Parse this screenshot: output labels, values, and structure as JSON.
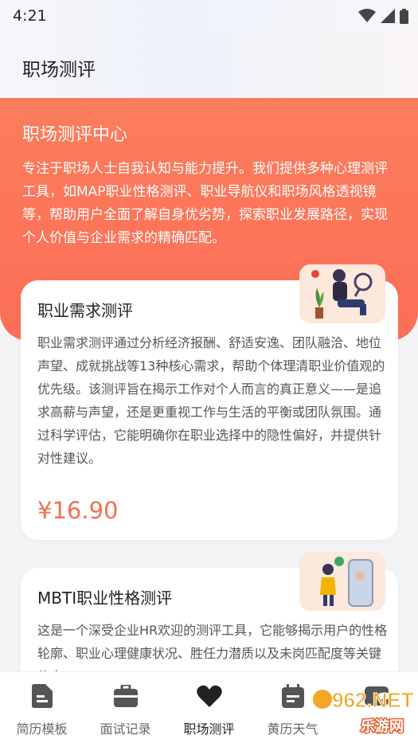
{
  "status_bar": {
    "time": "4:21"
  },
  "header": {
    "title": "职场测评"
  },
  "hero": {
    "title": "职场测评中心",
    "description": "专注于职场人士自我认知与能力提升。我们提供多种心理测评工具，如MAP职业性格测评、职业导航仪和职场风格透视镜等，帮助用户全面了解自身优劣势，探索职业发展路径，实现个人价值与企业需求的精确匹配。"
  },
  "cards": [
    {
      "title": "职业需求测评",
      "description": "职业需求测评通过分析经济报酬、舒适安逸、团队融洽、地位声望、成就挑战等13种核心需求，帮助个体理清职业价值观的优先级。该测评旨在揭示工作对个人而言的真正意义——是追求高薪与声望，还是更重视工作与生活的平衡或团队氛围。通过科学评估，它能明确你在职业选择中的隐性偏好，并提供针对性建议。",
      "price": "¥16.90"
    },
    {
      "title": "MBTI职业性格测评",
      "description": "这是一个深受企业HR欢迎的测评工具，它能够揭示用户的性格轮廓、职业心理健康状况、胜任力潜质以及未岗匹配度等关键信息"
    }
  ],
  "tabs": [
    {
      "label": "简历模板",
      "icon": "document-icon",
      "active": false
    },
    {
      "label": "面试记录",
      "icon": "briefcase-icon",
      "active": false
    },
    {
      "label": "职场测评",
      "icon": "heart-icon",
      "active": true
    },
    {
      "label": "黄历天气",
      "icon": "calendar-icon",
      "active": false
    },
    {
      "label": "",
      "icon": "wallet-icon",
      "active": false
    }
  ],
  "watermark": {
    "text": "962.NET",
    "subtext": "乐游网"
  },
  "colors": {
    "accent": "#fc6e57",
    "price": "#f0704f"
  }
}
